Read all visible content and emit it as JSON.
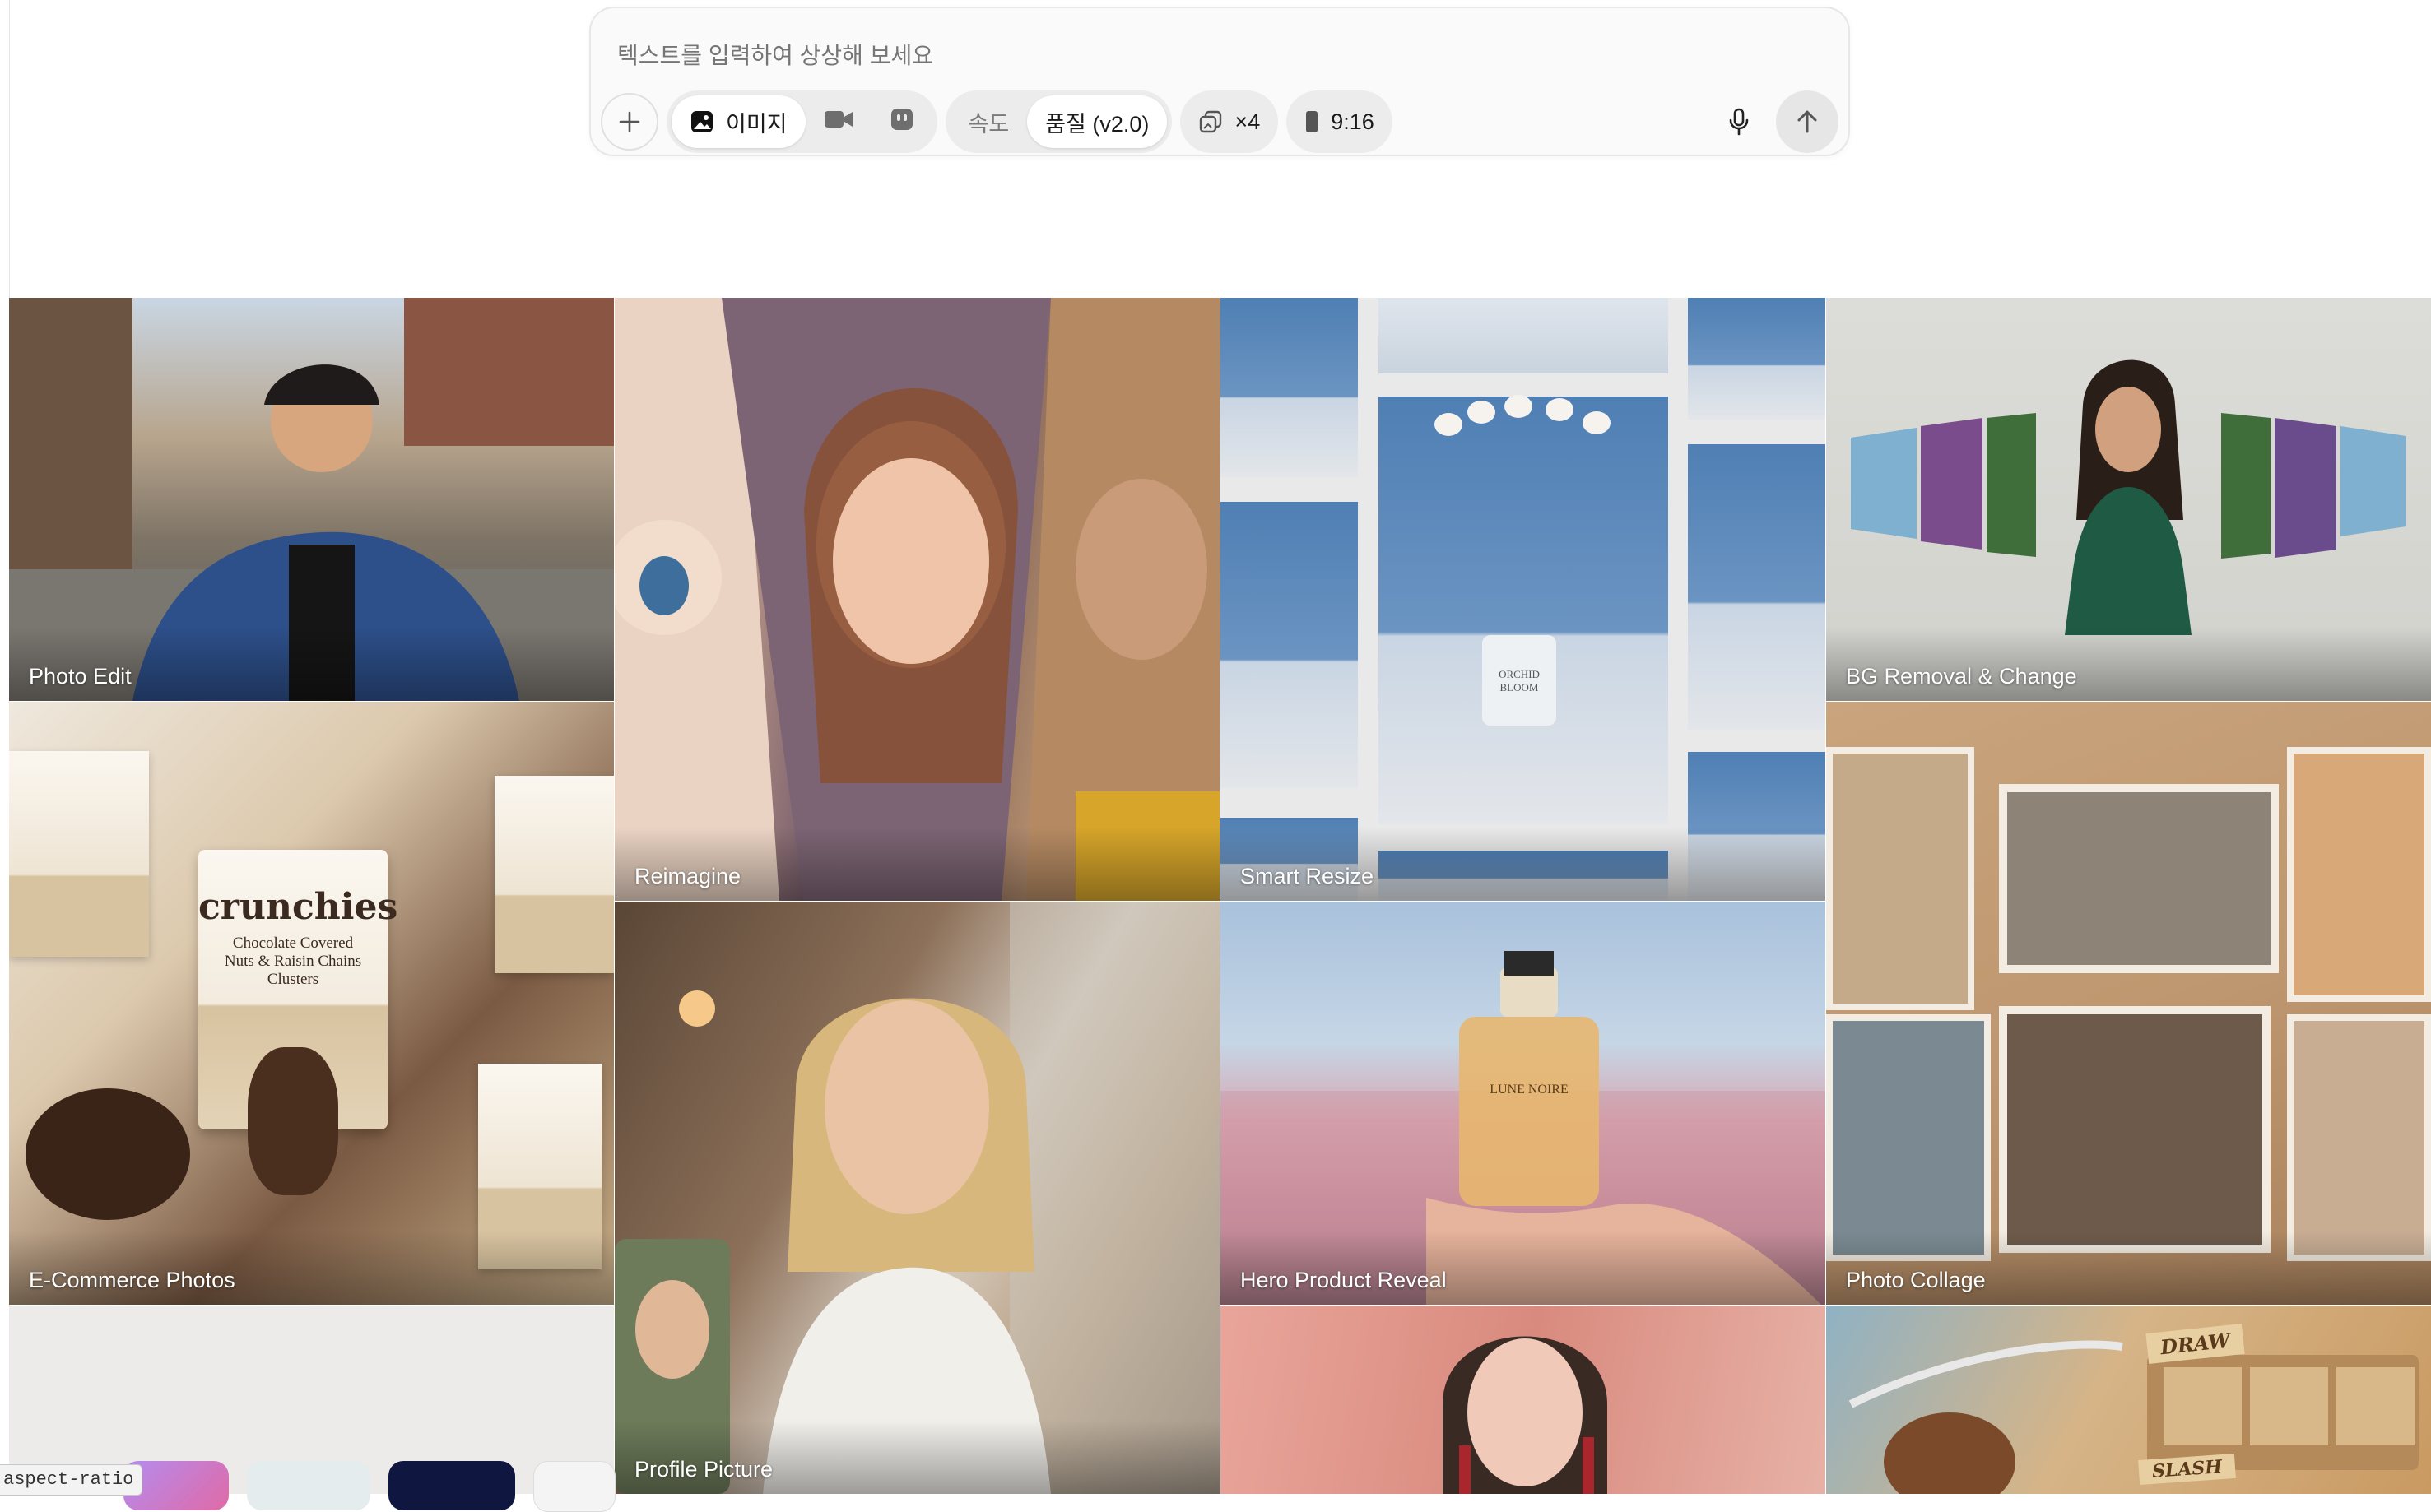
{
  "composer": {
    "placeholder": "텍스트를 입력하여 상상해 보세요",
    "add_icon": "plus-icon",
    "modes": [
      {
        "label": "이미지",
        "icon": "image-icon",
        "active": true
      },
      {
        "label": "",
        "icon": "video-camera-icon",
        "active": false
      },
      {
        "label": "",
        "icon": "avatar-icon",
        "active": false
      }
    ],
    "speed_label": "속도",
    "quality_label": "품질 (v2.0)",
    "count_label": "×4",
    "count_icon": "images-stack-icon",
    "ratio_label": "9:16",
    "ratio_icon": "portrait-ratio-icon",
    "mic_icon": "microphone-icon",
    "send_icon": "arrow-up-icon"
  },
  "gallery": {
    "tiles": [
      {
        "label": "Photo Edit"
      },
      {
        "label": "Reimagine"
      },
      {
        "label": "Smart Resize"
      },
      {
        "label": "BG Removal & Change"
      },
      {
        "label": "E-Commerce Photos"
      },
      {
        "label": "Photo Collage"
      },
      {
        "label": "Profile Picture"
      },
      {
        "label": "Hero Product Reveal"
      }
    ],
    "draw_text": "DRAW",
    "slash_text": "SLASH",
    "crunchies_text": "crunchies",
    "crunchies_sub": "Chocolate Covered Nuts & Raisin Chains Clusters",
    "perfume_text": "LUNE NOIRE",
    "orchid_text": "ORCHID BLOOM"
  },
  "footer": {
    "aspect_tag": "aspect-ratio"
  },
  "colors": {
    "composer_bg": "#fafafa",
    "active_segment": "#ffffff",
    "segment_group": "#ececec"
  }
}
